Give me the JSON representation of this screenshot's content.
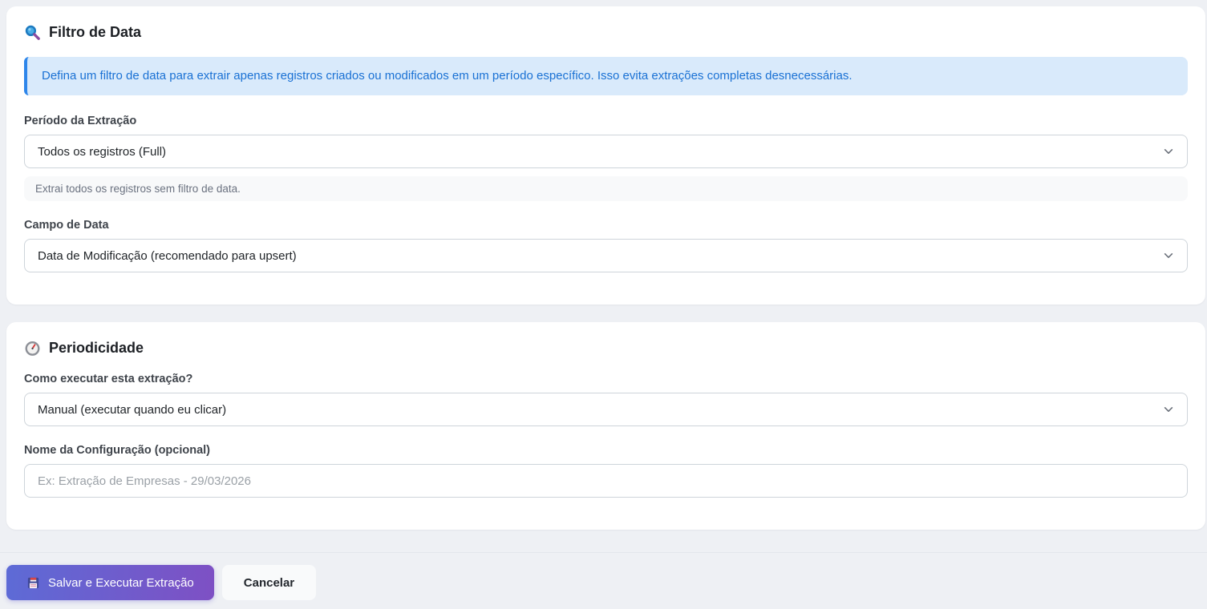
{
  "filter_card": {
    "title": "Filtro de Data",
    "info_alert": "Defina um filtro de data para extrair apenas registros criados ou modificados em um período específico. Isso evita extrações completas desnecessárias.",
    "period_field": {
      "label": "Período da Extração",
      "value": "Todos os registros (Full)",
      "help": "Extrai todos os registros sem filtro de data."
    },
    "date_field": {
      "label": "Campo de Data",
      "value": "Data de Modificação (recomendado para upsert)"
    }
  },
  "schedule_card": {
    "title": "Periodicidade",
    "execution_field": {
      "label": "Como executar esta extração?",
      "value": "Manual (executar quando eu clicar)"
    },
    "name_field": {
      "label": "Nome da Configuração (opcional)",
      "placeholder": "Ex: Extração de Empresas - 29/03/2026"
    }
  },
  "footer": {
    "save_label": "Salvar e Executar Extração",
    "cancel_label": "Cancelar"
  },
  "icons": {
    "filter_card_icon": "magnifier-icon",
    "schedule_card_icon": "timer-clock-icon",
    "save_button_icon": "floppy-disk-icon",
    "select_icon": "chevron-down-icon"
  },
  "colors": {
    "page_background": "#eef0f4",
    "card_background": "#ffffff",
    "alert_background": "#d9eafb",
    "alert_border": "#2e86ea",
    "alert_text": "#1a71d4",
    "button_gradient_start": "#5d6bd6",
    "button_gradient_end": "#7e50c4",
    "cancel_background": "#f9fafb",
    "input_border": "#ced4da",
    "help_background": "#f8f9fa"
  }
}
